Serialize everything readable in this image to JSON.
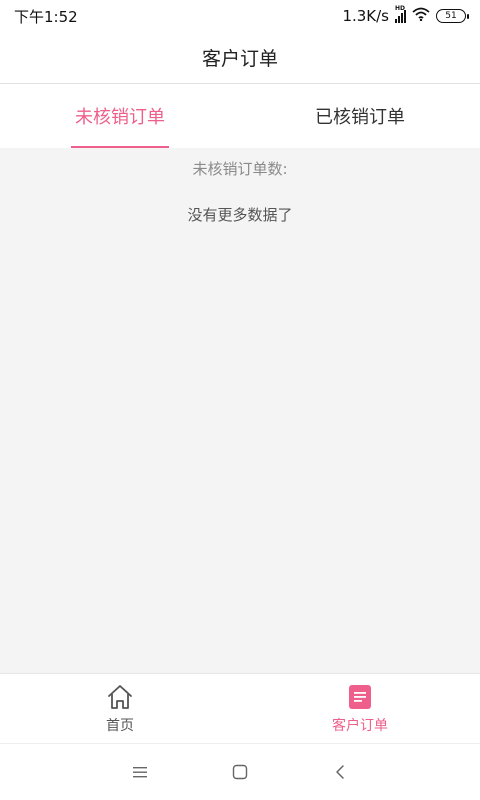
{
  "status_bar": {
    "time": "下午1:52",
    "net_speed": "1.3K/s",
    "hd_label": "HD",
    "battery": "51"
  },
  "header": {
    "title": "客户订单"
  },
  "tabs": [
    {
      "label": "未核销订单",
      "active": true
    },
    {
      "label": "已核销订单",
      "active": false
    }
  ],
  "content": {
    "count_label": "未核销订单数:",
    "empty_text": "没有更多数据了"
  },
  "bottom_nav": [
    {
      "label": "首页",
      "icon": "home-icon",
      "active": false
    },
    {
      "label": "客户订单",
      "icon": "order-list-icon",
      "active": true
    }
  ],
  "colors": {
    "accent": "#ee5f8b",
    "background": "#f4f4f4"
  }
}
